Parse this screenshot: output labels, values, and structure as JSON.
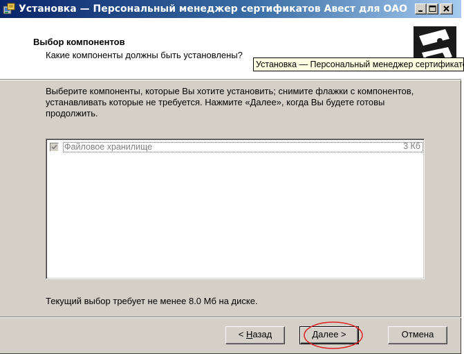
{
  "window": {
    "title": "Установка — Персональный менеджер сертификатов Авест для ОАО ..."
  },
  "header": {
    "title": "Выбор компонентов",
    "subtitle": "Какие компоненты должны быть установлены?",
    "tooltip": "Установка — Персональный менеджер сертификатов Авест для ОАО..."
  },
  "body": {
    "description": "Выберите компоненты, которые Вы хотите установить; снимите флажки с компонентов, устанавливать которые не требуется. Нажмите «Далее», когда Вы будете готовы продолжить.",
    "components": [
      {
        "label": "Файловое хранилище",
        "size": "3 Кб",
        "checked": true
      }
    ],
    "disk_requirement": "Текущий выбор требует не менее 8.0 Мб на диске."
  },
  "buttons": {
    "back": {
      "prefix": "< ",
      "underlined": "Н",
      "rest": "азад"
    },
    "next": {
      "underlined": "Д",
      "rest": "алее",
      "suffix": " >"
    },
    "cancel": "Отмена"
  },
  "colors": {
    "dialog_bg": "#d4d0c8",
    "title_gradient_start": "#0a246a",
    "title_gradient_end": "#a6caf0",
    "tooltip_bg": "#ffffe1",
    "annotation": "#e02020"
  },
  "icons": [
    "installer-icon",
    "minimize-icon",
    "maximize-icon",
    "close-icon",
    "setup-logo-icon",
    "checkmark-icon"
  ]
}
